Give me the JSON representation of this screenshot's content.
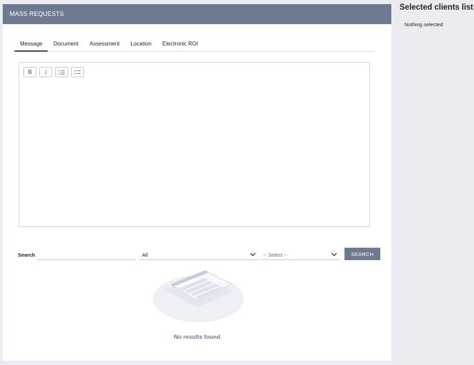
{
  "header": {
    "title": "MASS REQUESTS"
  },
  "tabs": [
    {
      "label": "Message",
      "active": true
    },
    {
      "label": "Document",
      "active": false
    },
    {
      "label": "Assessment",
      "active": false
    },
    {
      "label": "Location",
      "active": false
    },
    {
      "label": "Electronic ROI",
      "active": false
    }
  ],
  "editor": {
    "toolbar": [
      {
        "name": "bold-icon",
        "glyph": "B"
      },
      {
        "name": "italic-icon",
        "glyph": "I"
      },
      {
        "name": "ordered-list-icon",
        "glyph": "list"
      },
      {
        "name": "unordered-list-icon",
        "glyph": "list"
      }
    ],
    "content": ""
  },
  "search": {
    "label": "Search",
    "value": "",
    "filter_1": "All",
    "filter_2": "-- Select --",
    "button_label": "SEARCH"
  },
  "results": {
    "empty_text": "No results found"
  },
  "sidebar": {
    "title": "Selected clients list",
    "empty_text": "Nothing selected"
  },
  "colors": {
    "header_bg": "#6f7a91",
    "page_bg": "#ebecf1",
    "accent_text": "#6f7a91"
  }
}
